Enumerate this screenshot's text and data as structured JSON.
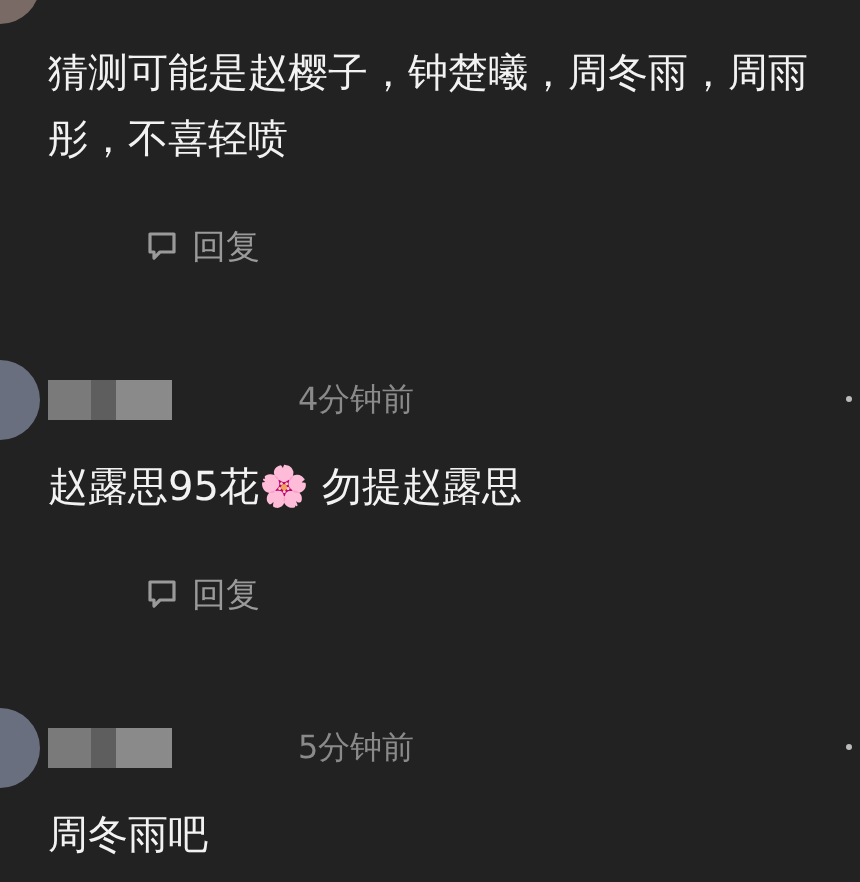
{
  "comments": [
    {
      "text": "猜测可能是赵樱子，钟楚曦，周冬雨，周雨彤，不喜轻喷",
      "reply": "回复"
    },
    {
      "time": "4分钟前",
      "text": "赵露思95花🌸 勿提赵露思",
      "reply": "回复"
    },
    {
      "time": "5分钟前",
      "text": "周冬雨吧"
    }
  ]
}
